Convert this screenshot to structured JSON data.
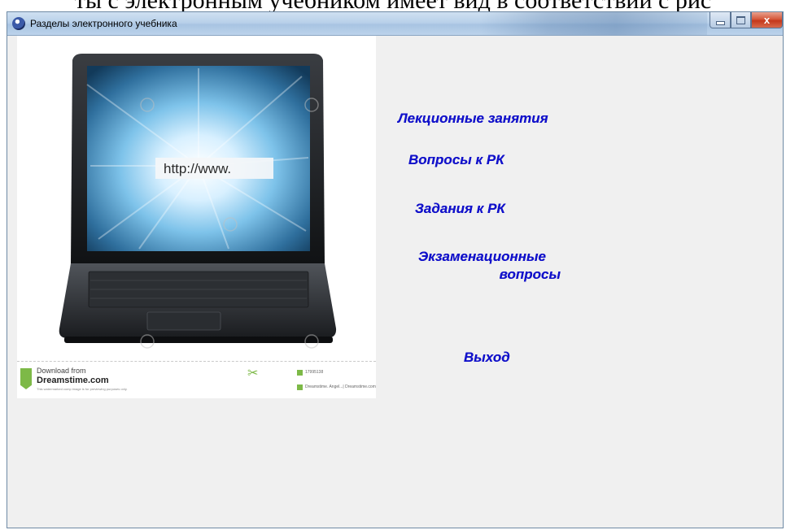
{
  "document_text": "ты с электронным учебником имеет вид в соответствии с рис",
  "window": {
    "title": "Разделы электронного учебника",
    "close_label": "x"
  },
  "image": {
    "address_text": "http://www.",
    "credit": {
      "download_from": "Download from",
      "site": "Dreamstime.com",
      "note": "This watermarked comp image is for previewing purposes only.",
      "id": "17995138",
      "by": "Dreamstime. Angel...| Dreamstime.com"
    }
  },
  "menu": {
    "lectures": "Лекционные занятия",
    "questions_rk": "Вопросы к РК",
    "tasks_rk": "Задания к РК",
    "exam_line1": "Экзаменационные",
    "exam_line2": "вопросы",
    "exit": "Выход"
  },
  "colors": {
    "link": "#1111cc",
    "titlebar": "#b9d1ea",
    "close_button": "#c4381b",
    "client_bg": "#f0f0f0"
  },
  "icons": [
    "app-icon",
    "minimize-icon",
    "maximize-icon",
    "close-icon",
    "scissors-icon",
    "dreamstime-logo"
  ]
}
